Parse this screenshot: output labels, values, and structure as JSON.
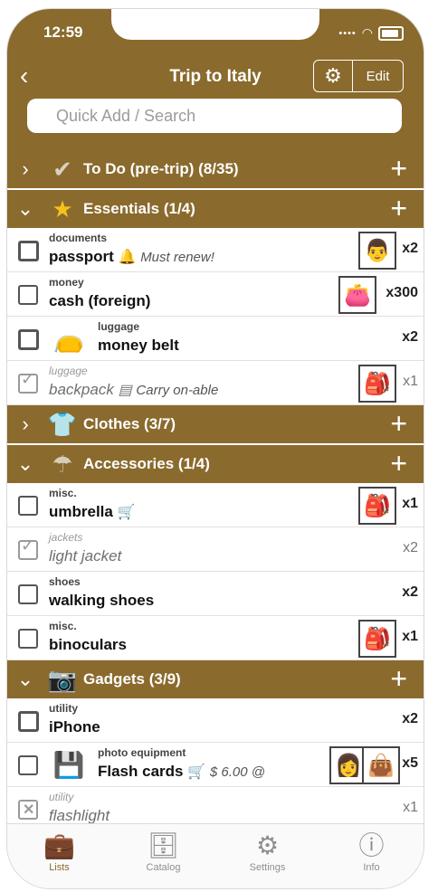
{
  "status": {
    "time": "12:59"
  },
  "header": {
    "back_icon": "chevron-left-icon",
    "title": "Trip to Italy",
    "settings_icon": "gears-icon",
    "edit_label": "Edit"
  },
  "search": {
    "placeholder": "Quick Add / Search"
  },
  "sections": [
    {
      "label": "To Do (pre-trip) (8/35)",
      "expanded": false,
      "icon": "checkmark-icon"
    },
    {
      "label": "Essentials (1/4)",
      "expanded": true,
      "icon": "star-icon"
    },
    {
      "label": "Clothes (3/7)",
      "expanded": false,
      "icon": "shirt-icon"
    },
    {
      "label": "Accessories (1/4)",
      "expanded": true,
      "icon": "umbrella-icon"
    },
    {
      "label": "Gadgets (3/9)",
      "expanded": true,
      "icon": "camera-icon"
    }
  ],
  "items": {
    "essentials": [
      {
        "category": "documents",
        "name": "passport",
        "note": "Must renew!",
        "note_icon": "bell-icon",
        "assignee": "man-icon",
        "qty": "x2",
        "checked": false
      },
      {
        "category": "money",
        "name": "cash (foreign)",
        "assignee": "wallet-icon",
        "qty": "x300",
        "checked": false
      },
      {
        "category": "luggage",
        "name": "money belt",
        "thumb": "belt-icon",
        "qty": "x2",
        "checked": false
      },
      {
        "category": "luggage",
        "name": "backpack",
        "note": "Carry on-able",
        "note_icon": "document-icon",
        "assignee": "backpack-icon",
        "qty": "x1",
        "checked": true
      }
    ],
    "accessories": [
      {
        "category": "misc.",
        "name": "umbrella",
        "note_icon": "cart-icon",
        "assignee": "backpack-icon",
        "qty": "x1",
        "checked": false
      },
      {
        "category": "jackets",
        "name": "light jacket",
        "qty": "x2",
        "checked": true
      },
      {
        "category": "shoes",
        "name": "walking shoes",
        "qty": "x2",
        "checked": false
      },
      {
        "category": "misc.",
        "name": "binoculars",
        "assignee": "backpack-icon",
        "qty": "x1",
        "checked": false
      }
    ],
    "gadgets": [
      {
        "category": "utility",
        "name": "iPhone",
        "qty": "x2",
        "checked": false
      },
      {
        "category": "photo equipment",
        "name": "Flash cards",
        "price": "$ 6.00 @",
        "note_icon": "cart-icon",
        "thumb": "sd-card-icon",
        "assignees": [
          "woman-icon",
          "handbag-icon"
        ],
        "qty": "x5",
        "checked": false
      },
      {
        "category": "utility",
        "name": "flashlight",
        "qty": "x1",
        "checked": true
      }
    ]
  },
  "tabbar": [
    {
      "label": "Lists",
      "icon": "suitcase-icon",
      "active": true
    },
    {
      "label": "Catalog",
      "icon": "catalog-icon",
      "active": false
    },
    {
      "label": "Settings",
      "icon": "gear-icon",
      "active": false
    },
    {
      "label": "Info",
      "icon": "info-icon",
      "active": false
    }
  ],
  "colors": {
    "accent": "#8a6a2d",
    "active_tab": "#8a6a2d",
    "inactive_tab": "#8e8e8e"
  }
}
